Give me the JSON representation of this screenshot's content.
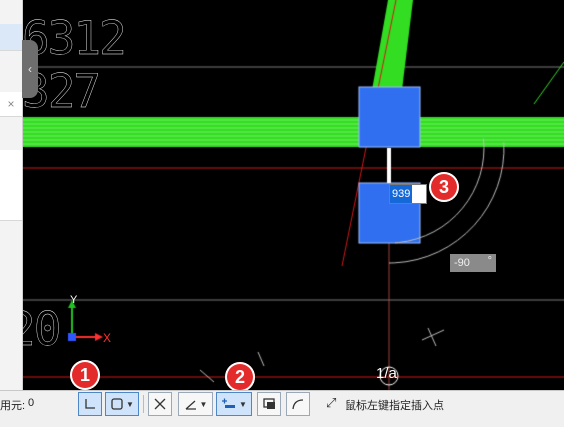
{
  "canvas": {
    "drawing_numbers": [
      "6312",
      "327",
      "20"
    ],
    "dimension_input_value": "939",
    "angle_value": "-90",
    "angle_unit": "°",
    "grid_label": "1/a",
    "axis_labels": {
      "x": "X",
      "y": "Y"
    }
  },
  "markers": [
    "1",
    "2",
    "3"
  ],
  "left_panel": {
    "close_glyph": "×",
    "collapse_glyph": "‹"
  },
  "statusbar": {
    "label": "用元:",
    "value": "0",
    "prompt": "鼠标左键指定插入点"
  },
  "icons": [
    "orthogonal-icon",
    "snap-box-icon",
    "intersection-icon",
    "angle-icon",
    "offset-icon",
    "dynamic-input-icon",
    "arc-icon",
    "resize-arrow-icon"
  ],
  "colors": {
    "background": "#000000",
    "beam": "#33dd22",
    "column": "#2f6ff0",
    "grid_red": "#d01818",
    "marker": "#e42b2b",
    "toolbar_active": "#cfe3fa"
  }
}
